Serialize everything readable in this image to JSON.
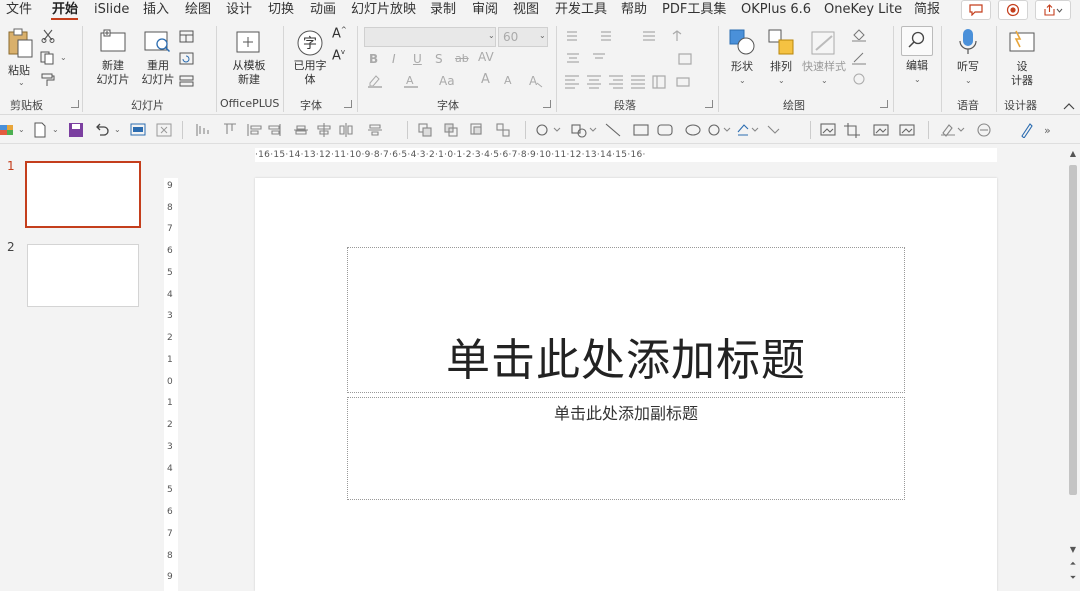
{
  "menu": {
    "items": [
      "文件",
      "开始",
      "iSlide",
      "插入",
      "绘图",
      "设计",
      "切换",
      "动画",
      "幻灯片放映",
      "录制",
      "审阅",
      "视图",
      "开发工具",
      "帮助",
      "PDF工具集",
      "OKPlus 6.6",
      "OneKey Lite",
      "简报"
    ],
    "active": "开始"
  },
  "ribbon": {
    "clipboard": {
      "paste": "粘贴",
      "group": "剪贴板"
    },
    "slides": {
      "new": "新建\n幻灯片",
      "new_line1": "新建",
      "new_line2": "幻灯片",
      "reuse_line1": "重用",
      "reuse_line2": "幻灯片",
      "group": "幻灯片"
    },
    "officeplus": {
      "line1": "从模板",
      "line2": "新建",
      "group": "OfficePLUS"
    },
    "fontgroup1": {
      "line1": "已用字",
      "line2": "体",
      "group": "字体"
    },
    "font": {
      "size": "60",
      "bold": "B",
      "italic": "I",
      "underline": "U",
      "strike": "S",
      "case": "Aa",
      "grow": "A",
      "shrink": "A",
      "group": "字体"
    },
    "paragraph": {
      "group": "段落"
    },
    "drawing": {
      "shape": "形状",
      "arrange": "排列",
      "quickstyle": "快速样式",
      "group": "绘图"
    },
    "edit": {
      "label": "编辑"
    },
    "voice": {
      "label": "听写",
      "group": "语音"
    },
    "designer": {
      "line1": "设",
      "line2": "计器",
      "group": "设计器"
    }
  },
  "rulers": {
    "horizontal": "·16·15·14·13·12·11·10·9·8·7·6·5·4·3·2·1·0·1·2·3·4·5·6·7·8·9·10·11·12·13·14·15·16·",
    "vertical": [
      "9",
      "8",
      "7",
      "6",
      "5",
      "4",
      "3",
      "2",
      "1",
      "0",
      "1",
      "2",
      "3",
      "4",
      "5",
      "6",
      "7",
      "8",
      "9"
    ]
  },
  "thumbnails": [
    {
      "number": "1",
      "selected": true
    },
    {
      "number": "2",
      "selected": false
    }
  ],
  "slide": {
    "title_placeholder": "单击此处添加标题",
    "subtitle_placeholder": "单击此处添加副标题"
  },
  "colors": {
    "accent": "#c43e1c",
    "ribbon_bg": "#f3f3f3",
    "canvas_bg": "#ffffff"
  }
}
